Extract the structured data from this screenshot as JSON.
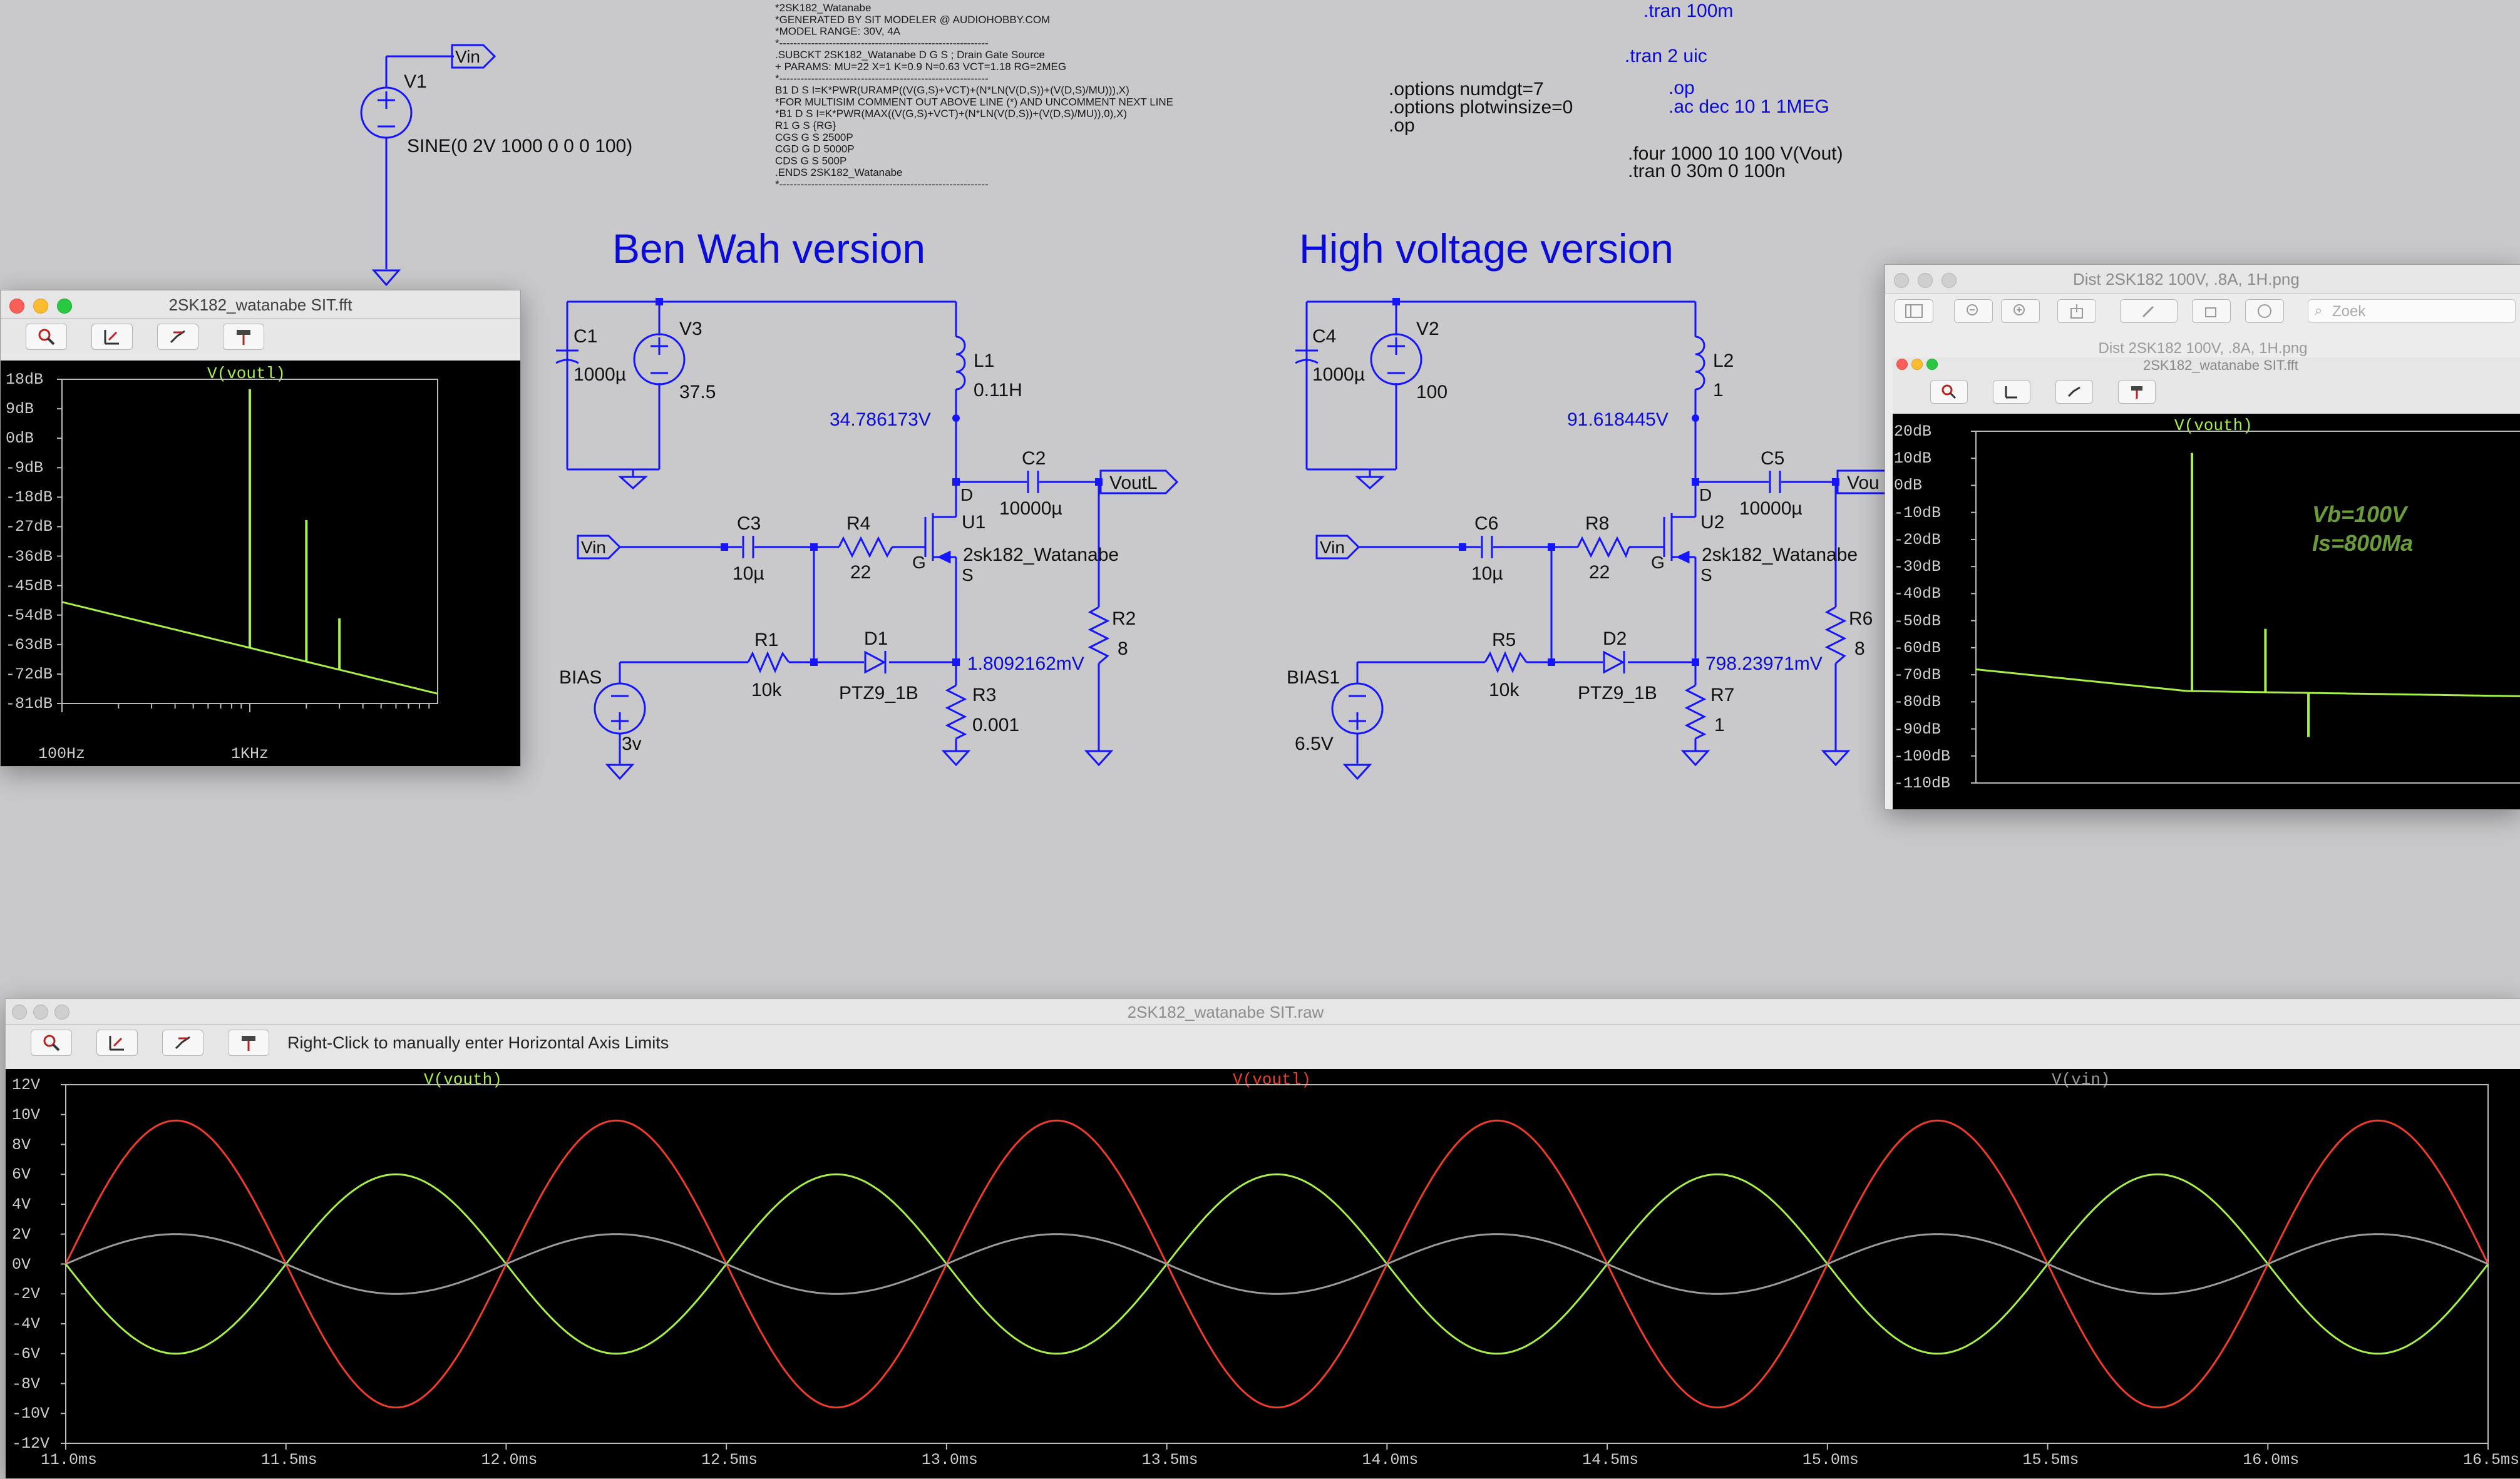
{
  "netlist": {
    "spice_lines": [
      "*2SK182_Watanabe",
      "*GENERATED BY SIT MODELER @ AUDIOHOBBY.COM",
      "*MODEL RANGE: 30V, 4A",
      "*-----------------------------------------------------------",
      ".SUBCKT 2SK182_Watanabe D G S ; Drain Gate Source",
      "+ PARAMS: MU=22 X=1 K=0.9 N=0.63 VCT=1.18 RG=2MEG",
      "*-----------------------------------------------------------",
      "B1 D S I=K*PWR(URAMP((V(G,S)+VCT)+(N*LN(V(D,S))+(V(D,S)/MU))),X)",
      "*FOR MULTISIM COMMENT OUT ABOVE LINE (*) AND UNCOMMENT NEXT LINE",
      "*B1 D S I=K*PWR(MAX((V(G,S)+VCT)+(N*LN(V(D,S))+(V(D,S)/MU)),0),X)",
      "R1 G S {RG}",
      "CGS G S 2500P",
      "CGD G D 5000P",
      "CDS G S 500P",
      ".ENDS 2SK182_Watanabe",
      "*-----------------------------------------------------------"
    ],
    "options_lines": [
      ".options numdgt=7",
      ".options plotwinsize=0",
      ".op"
    ],
    "tran1": ".tran 100m",
    "tran2": ".tran 2 uic",
    "op": ".op",
    "ac": ".ac dec 10 1 1MEG",
    "four_line": ".four 1000 10 100 V(Vout)",
    "tran3": ".tran 0 30m 0 100n"
  },
  "schematic": {
    "v1": {
      "name": "V1",
      "label": "Vin",
      "value": "SINE(0 2V 1000 0 0 0 100)"
    },
    "left": {
      "title": "Ben Wah version",
      "c1_name": "C1",
      "c1_val": "1000µ",
      "v3_name": "V3",
      "v3_val": "37.5",
      "l1_name": "L1",
      "l1_val": "0.11H",
      "drain_voltage": "34.786173V",
      "c2_name": "C2",
      "c2_val": "10000µ",
      "out_label": "VoutL",
      "vin_label": "Vin",
      "c3_name": "C3",
      "c3_val": "10µ",
      "r4_name": "R4",
      "r4_val": "22",
      "u1_name": "U1",
      "u1_model": "2sk182_Watanabe",
      "pin_d": "D",
      "pin_g": "G",
      "pin_s": "S",
      "bias_name": "BIAS",
      "bias_val": "3v",
      "r1_name": "R1",
      "r1_val": "10k",
      "d1_name": "D1",
      "d1_model": "PTZ9_1B",
      "source_voltage": "1.8092162mV",
      "r2_name": "R2",
      "r2_val": "8",
      "r3_name": "R3",
      "r3_val": "0.001"
    },
    "right": {
      "title": "High voltage version",
      "c4_name": "C4",
      "c4_val": "1000µ",
      "v2_name": "V2",
      "v2_val": "100",
      "l2_name": "L2",
      "l2_val": "1",
      "drain_voltage": "91.618445V",
      "c5_name": "C5",
      "c5_val": "10000µ",
      "out_label": "Vou",
      "vin_label": "Vin",
      "c6_name": "C6",
      "c6_val": "10µ",
      "r8_name": "R8",
      "r8_val": "22",
      "u2_name": "U2",
      "u2_model": "2sk182_Watanabe",
      "pin_d": "D",
      "pin_g": "G",
      "pin_s": "S",
      "bias_name": "BIAS1",
      "bias_val": "6.5V",
      "r5_name": "R5",
      "r5_val": "10k",
      "d2_name": "D2",
      "d2_model": "PTZ9_1B",
      "source_voltage": "798.23971mV",
      "r6_name": "R6",
      "r6_val": "8",
      "r7_name": "R7",
      "r7_val": "1"
    }
  },
  "fft_window": {
    "title": "2SK182_watanabe SIT.fft",
    "trace": "V(voutl)",
    "y_ticks": [
      "18dB",
      "9dB",
      "0dB",
      "-9dB",
      "-18dB",
      "-27dB",
      "-36dB",
      "-45dB",
      "-54dB",
      "-63dB",
      "-72dB",
      "-81dB"
    ],
    "x_ticks": [
      "100Hz",
      "1KHz"
    ]
  },
  "preview_window": {
    "title": "Dist 2SK182 100V, .8A, 1H.png",
    "subtitle": "Dist 2SK182 100V, .8A, 1H.png",
    "search_placeholder": "Zoek",
    "inner_title": "2SK182_watanabe SIT.fft",
    "trace": "V(vouth)",
    "annotation_line1": "Vb=100V",
    "annotation_line2": "Is=800Ma",
    "y_ticks": [
      "20dB",
      "10dB",
      "0dB",
      "-10dB",
      "-20dB",
      "-30dB",
      "-40dB",
      "-50dB",
      "-60dB",
      "-70dB",
      "-80dB",
      "-90dB",
      "-100dB",
      "-110dB"
    ]
  },
  "raw_window": {
    "title": "2SK182_watanabe SIT.raw",
    "hint": "Right-Click to manually enter Horizontal Axis Limits",
    "traces": [
      "V(vouth)",
      "V(voutl)",
      "V(vin)"
    ],
    "y_ticks": [
      "12V",
      "10V",
      "8V",
      "6V",
      "4V",
      "2V",
      "0V",
      "-2V",
      "-4V",
      "-6V",
      "-8V",
      "-10V",
      "-12V"
    ],
    "x_ticks": [
      "11.0ms",
      "11.5ms",
      "12.0ms",
      "12.5ms",
      "13.0ms",
      "13.5ms",
      "14.0ms",
      "14.5ms",
      "15.0ms",
      "15.5ms",
      "16.0ms",
      "16.5ms"
    ]
  },
  "chart_data": [
    {
      "type": "line",
      "x_unit": "ms",
      "xlim": [
        11.0,
        16.5
      ],
      "ylim": [
        -12,
        12
      ],
      "grid": false,
      "series": [
        {
          "name": "V(vouth)",
          "color": "#a6f04a",
          "amplitude": 6.0,
          "frequency_hz": 1000
        },
        {
          "name": "V(voutl)",
          "color": "#f03c28",
          "amplitude": 9.6,
          "frequency_hz": 1000
        },
        {
          "name": "V(vin)",
          "color": "#9a9a9a",
          "amplitude": 2.0,
          "frequency_hz": 1000
        }
      ]
    },
    {
      "type": "line",
      "x_scale": "log",
      "ylim": [
        -81,
        18
      ],
      "series": [
        {
          "name": "V(voutl)",
          "color": "#a6f04a",
          "noise_floor_start_db": -50,
          "noise_floor_end_db": -78,
          "fundamental_db": 15,
          "h2_db": -25,
          "h3_db": -55
        }
      ]
    },
    {
      "type": "line",
      "x_scale": "log",
      "ylim": [
        -110,
        20
      ],
      "series": [
        {
          "name": "V(vouth)",
          "color": "#a6f04a",
          "noise_floor_start_db": -68,
          "noise_floor_end_db": -78,
          "fundamental_db": 12,
          "h2_db": -53,
          "h3_db": -93
        }
      ]
    }
  ],
  "colors": {
    "wire": "#1515ff",
    "label": "#0b0bd8",
    "background": "#c9c9cb",
    "green_trace": "#a6f04a",
    "red_trace": "#f03c28",
    "gray_trace": "#9a9a9a"
  }
}
